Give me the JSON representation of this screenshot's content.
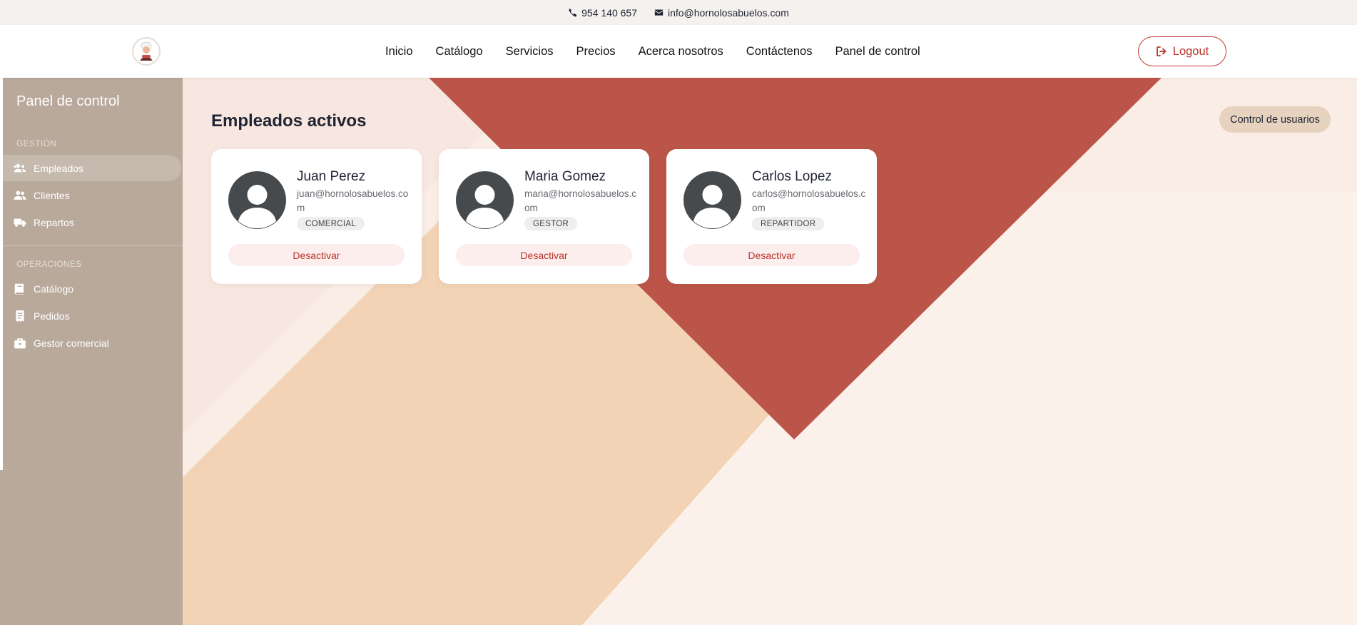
{
  "topbar": {
    "phone": "954 140 657",
    "email": "info@hornolosabuelos.com",
    "phone_icon": "phone-icon",
    "email_icon": "envelope-icon"
  },
  "header": {
    "nav": [
      "Inicio",
      "Catálogo",
      "Servicios",
      "Precios",
      "Acerca nosotros",
      "Contáctenos",
      "Panel de control"
    ],
    "logout_label": "Logout",
    "logout_icon": "sign-out-icon"
  },
  "sidebar": {
    "title": "Panel de control",
    "sections": [
      {
        "label": "GESTIÓN",
        "items": [
          {
            "label": "Empleados",
            "icon": "users-icon",
            "active": true
          },
          {
            "label": "Clientes",
            "icon": "user-group-icon",
            "active": false
          },
          {
            "label": "Repartos",
            "icon": "truck-icon",
            "active": false
          }
        ]
      },
      {
        "label": "OPERACIONES",
        "items": [
          {
            "label": "Catálogo",
            "icon": "book-icon",
            "active": false
          },
          {
            "label": "Pedidos",
            "icon": "receipt-icon",
            "active": false
          },
          {
            "label": "Gestor comercial",
            "icon": "briefcase-icon",
            "active": false
          }
        ]
      }
    ]
  },
  "main": {
    "title": "Empleados activos",
    "control_button": "Control de usuarios",
    "employees": [
      {
        "name": "Juan Perez",
        "email": "juan@hornolosabuelos.com",
        "role": "COMERCIAL",
        "action": "Desactivar"
      },
      {
        "name": "Maria Gomez",
        "email": "maria@hornolosabuelos.com",
        "role": "GESTOR",
        "action": "Desactivar"
      },
      {
        "name": "Carlos Lopez",
        "email": "carlos@hornolosabuelos.com",
        "role": "REPARTIDOR",
        "action": "Desactivar"
      }
    ]
  },
  "colors": {
    "accent": "#b83227",
    "sidebar": "#b8a99b",
    "triangle_red": "#bc5549",
    "peach": "#f3d3b5"
  }
}
